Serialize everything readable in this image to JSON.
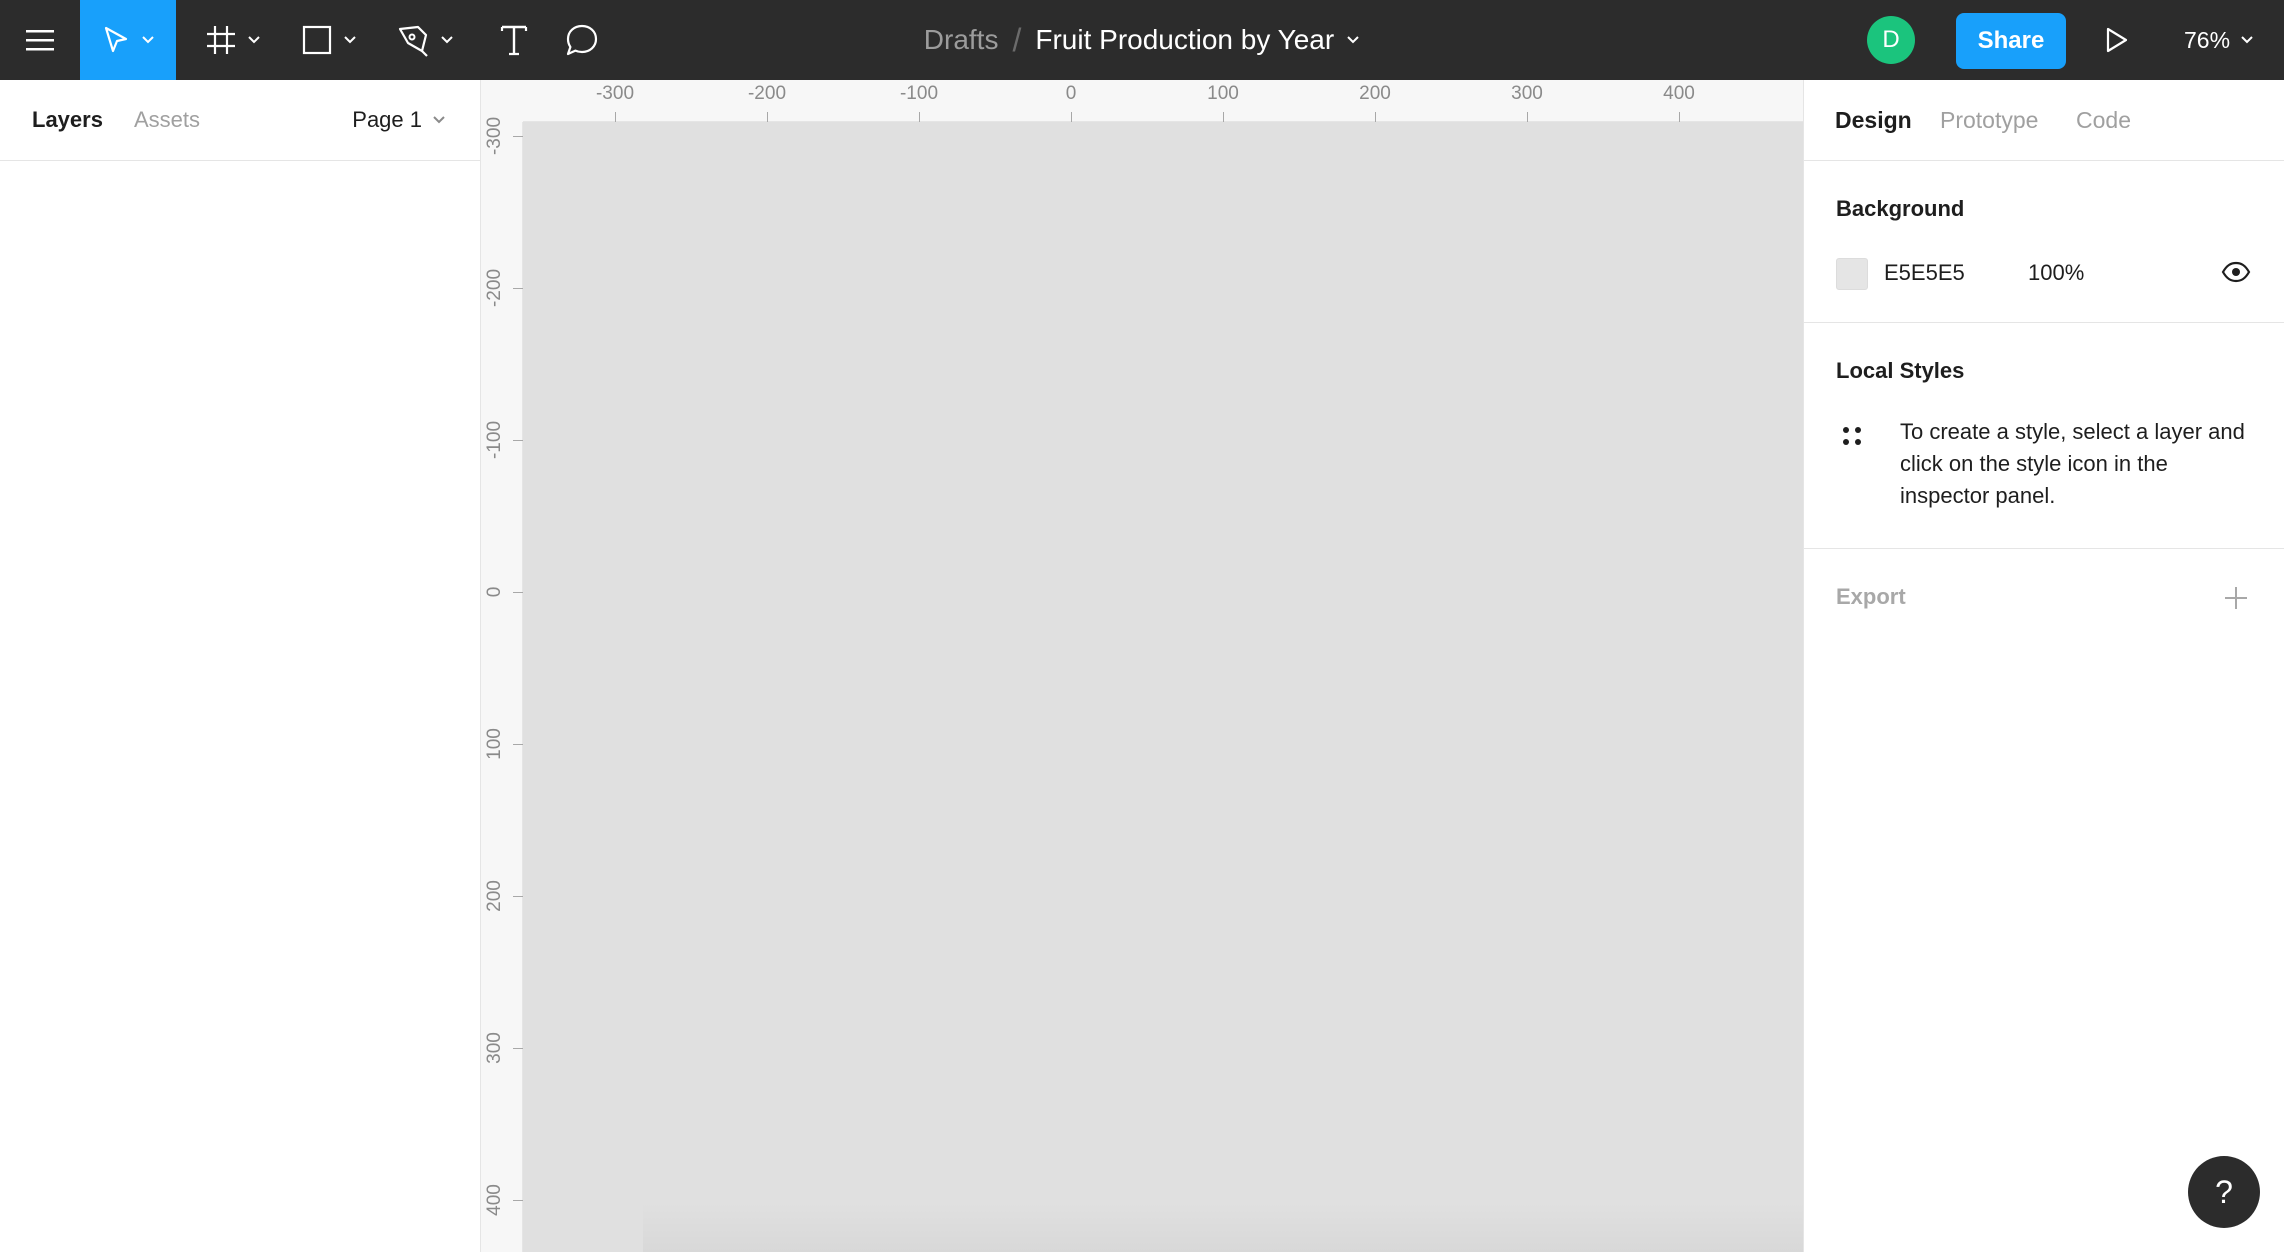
{
  "toolbar": {
    "menu_icon": "hamburger-menu-icon",
    "tools": [
      {
        "name": "move-tool",
        "icon": "cursor-arrow-icon",
        "active": true
      },
      {
        "name": "frame-tool",
        "icon": "frame-hash-icon",
        "active": false
      },
      {
        "name": "shape-tool",
        "icon": "rectangle-icon",
        "active": false
      },
      {
        "name": "pen-tool",
        "icon": "pen-icon",
        "active": false
      },
      {
        "name": "text-tool",
        "icon": "text-t-icon",
        "active": false
      },
      {
        "name": "comment-tool",
        "icon": "speech-bubble-icon",
        "active": false
      }
    ],
    "breadcrumb_root": "Drafts",
    "breadcrumb_sep": "/",
    "file_name": "Fruit Production by Year",
    "avatar_initial": "D",
    "avatar_color": "#1bc47d",
    "share_label": "Share",
    "zoom_label": "76%"
  },
  "left_panel": {
    "tabs": [
      {
        "label": "Layers",
        "active": true
      },
      {
        "label": "Assets",
        "active": false
      }
    ],
    "page_label": "Page 1"
  },
  "rulers": {
    "horizontal": [
      "-300",
      "-200",
      "-100",
      "0",
      "100",
      "200",
      "300",
      "400"
    ],
    "vertical": [
      "-300",
      "-200",
      "-100",
      "0",
      "100",
      "200",
      "300",
      "400"
    ]
  },
  "canvas": {
    "background_color": "#E0E0E0"
  },
  "right_panel": {
    "tabs": [
      {
        "label": "Design",
        "active": true
      },
      {
        "label": "Prototype",
        "active": false
      },
      {
        "label": "Code",
        "active": false
      }
    ],
    "background": {
      "title": "Background",
      "hex": "E5E5E5",
      "opacity": "100%",
      "swatch_color": "#E5E5E5"
    },
    "local_styles": {
      "title": "Local Styles",
      "hint": "To create a style, select a layer and click on the style icon in the inspector panel."
    },
    "export": {
      "title": "Export"
    }
  },
  "help_label": "?",
  "accent_color": "#18a0fb"
}
